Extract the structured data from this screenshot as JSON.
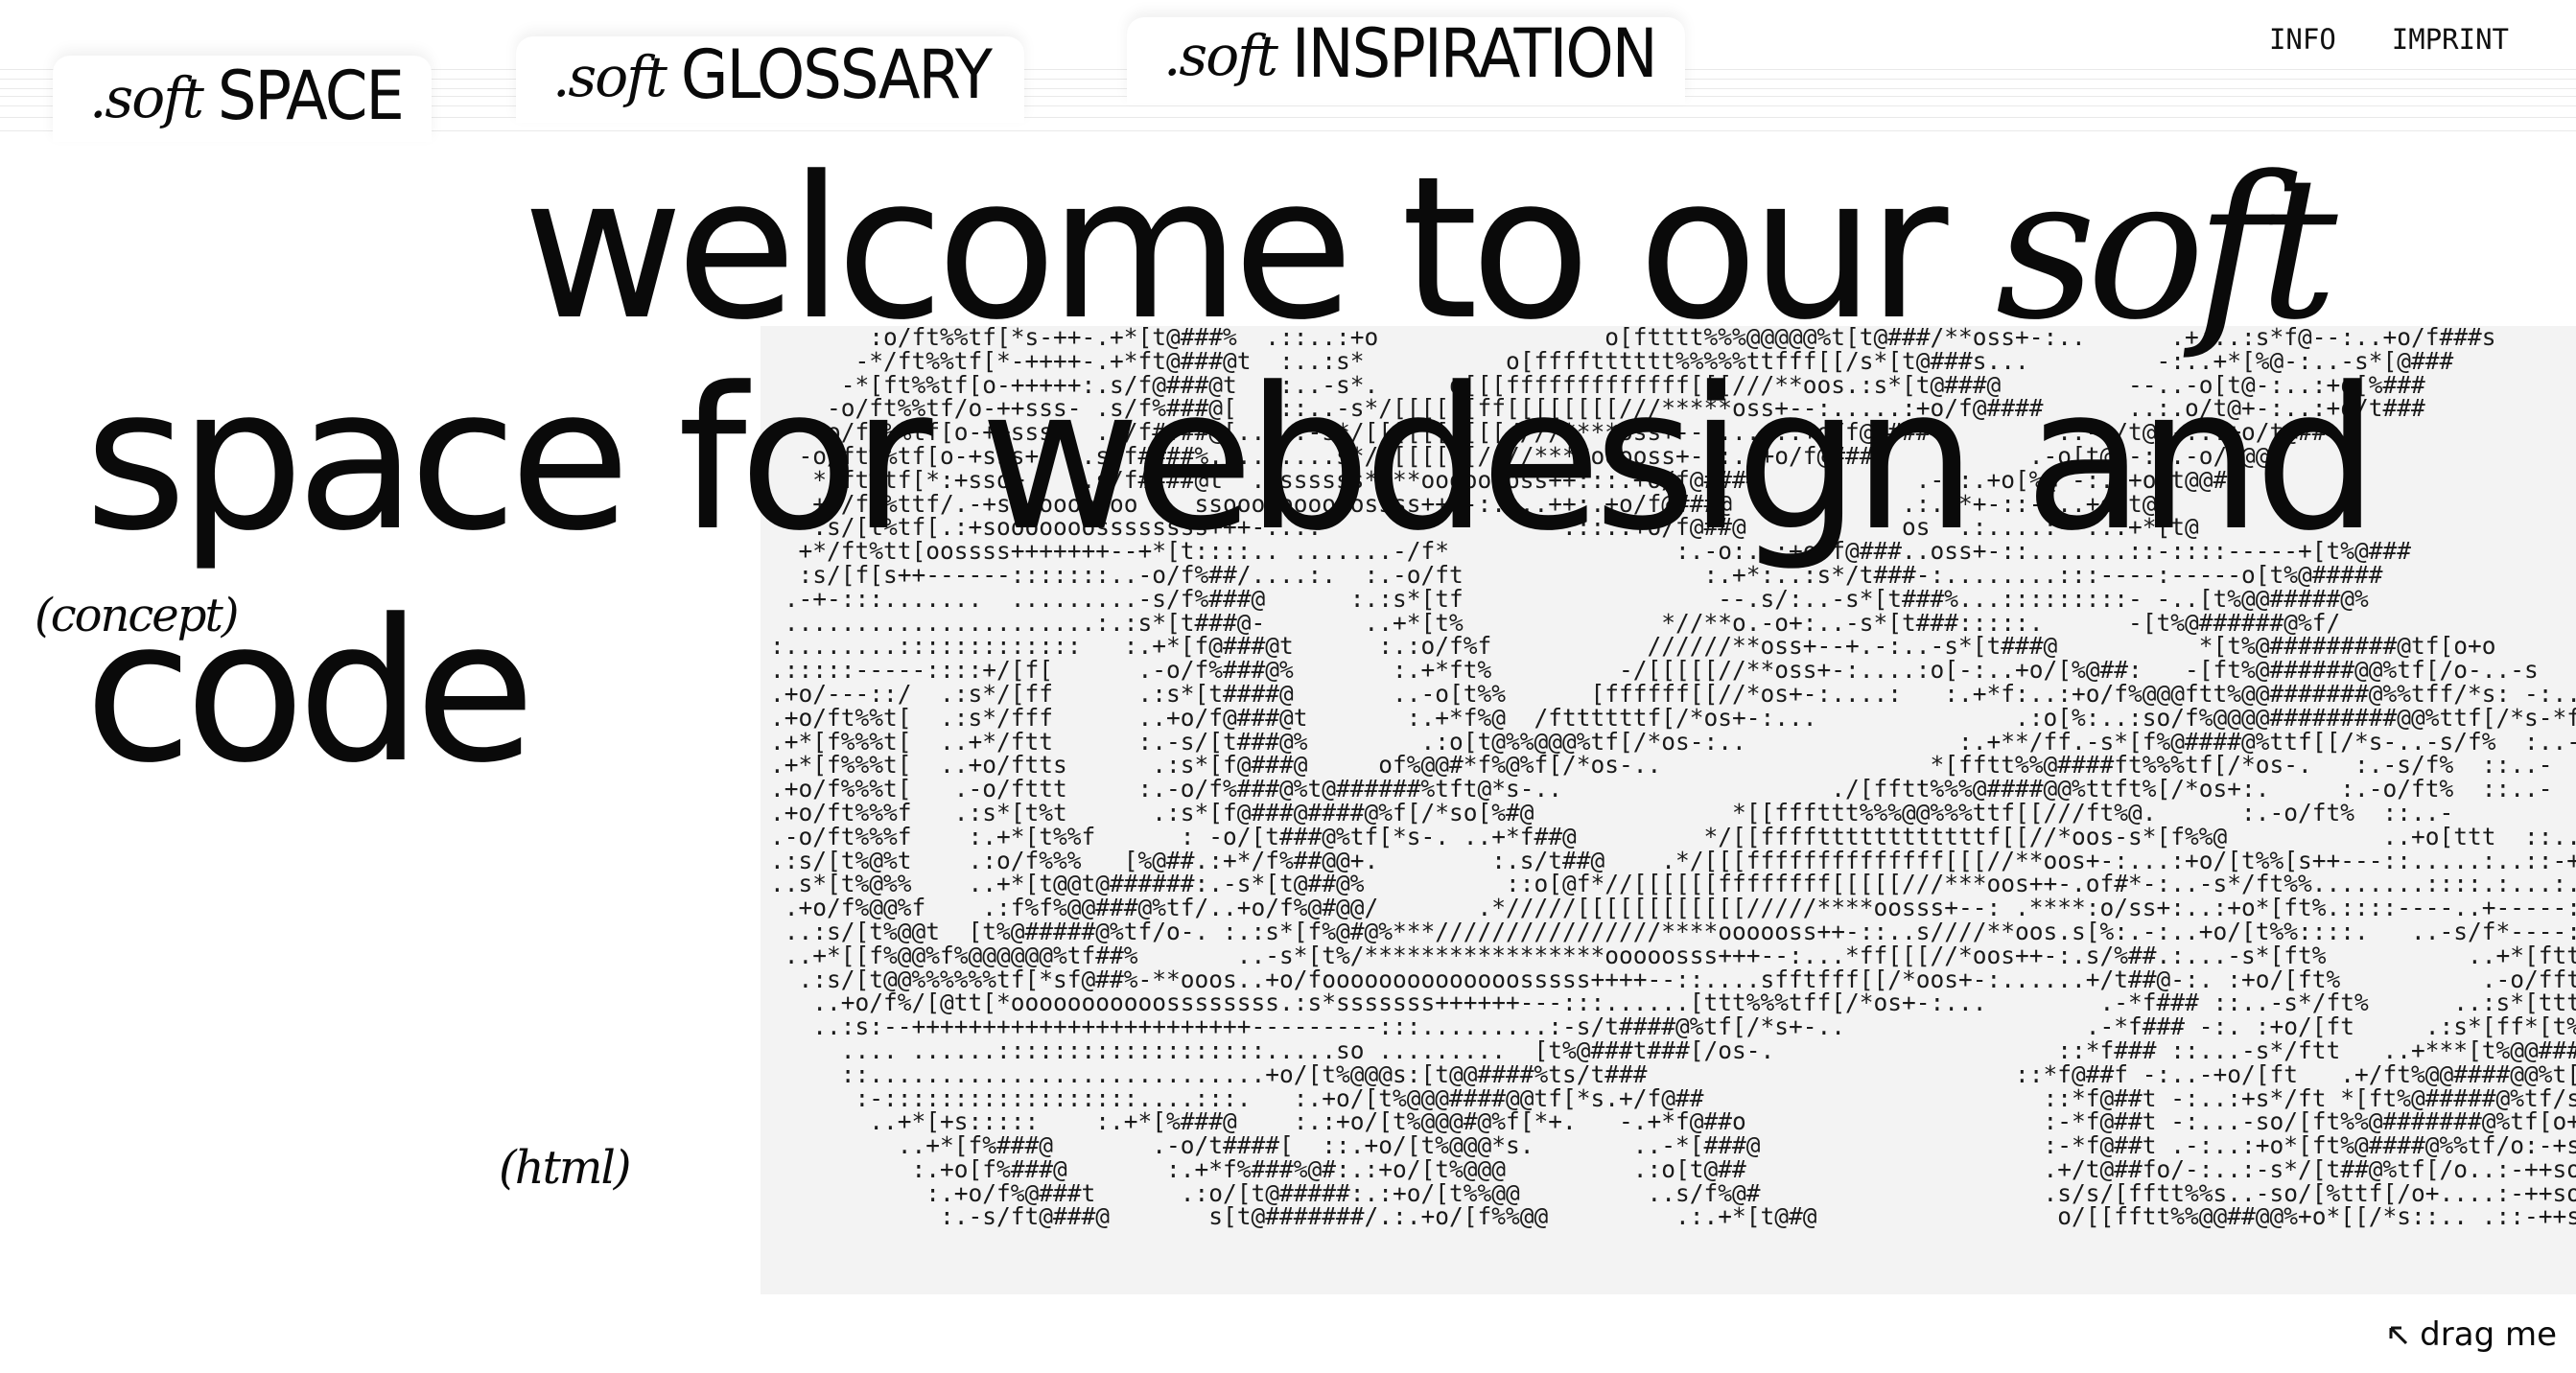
{
  "tabs": [
    {
      "prefix": ".soft",
      "label": "SPACE"
    },
    {
      "prefix": ".soft",
      "label": "GLOSSARY"
    },
    {
      "prefix": ".soft",
      "label": "INSPIRATION"
    }
  ],
  "nav": {
    "info": "INFO",
    "imprint": "IMPRINT"
  },
  "hero": {
    "line1": "welcome to our",
    "soft": "soft",
    "line2": "space for webdesign and",
    "line3": "code"
  },
  "annotations": {
    "concept": "(concept)",
    "html": "(html)"
  },
  "drag": {
    "icon": "arrow-up-left-icon",
    "label": "drag me"
  },
  "ascii_art": [
    "       :o/ft%%tf[*s-++-.+*[t@###%  .::..:+o                o[ftttt%%%@@@@@%t[t@###/**oss+-:..      .+:..:s*f@--:..+o/f###s",
    "      -*/ft%%tf[*-++++-.+*ft@###@t  :..:s*          o[fffftttttt%%%%%ttfff[[/s*[t@###s...         -:..+*[%@-:..-s*[@###",
    "     -*[ft%%tf[o-+++++:.s/f@###@t   :..-s*.     o[[[fffffffffffff[[[///**oos.:s*[t@###@         --..-o[t@-:..:+o[%###",
    "    -o/ft%%tf/o-++sss- .s/f%###@[   ::..-s*/[[[[[[ff[[[[[[[[///*****oss+--:.....:+o/f@####      ..:.o/t@+-:..:+o/t###",
    "   -o/ft%%tf[o-++sss+  .s/f####@[.....-s*/[[[[[[[[[[////****oss+--:.....:+o/f@####         ..-o/t@%-:..+o/t@##",
    "  -o/ft%%tf[o-+sss+   .s/f####%.........s*//[[[[[[////****ooooss+-::.:+o/f@####          .-o[t@[-:..-o/f@@#",
    "   *[ft%tf[*:+sso+    .s/f####@t  .ossssss****oooooooss++:::.+o/f@####           .-.:.+o[%@ -:..+o/t@@#",
    "   +s/ft%ttf/.-+ss+ooooooo    ssoooooooooossss++--:....++:.+o/f@###@            .:.+*+-::-:..+o/t@",
    "   .s/[t%tf[.:+sooooooossssssss+++-:...                 .::.:+o/f@##@           os  .:....:--..:+*[t@",
    "  +*/ft%tt[oossss+++++++--+*[t::::.. .......-/f*                :.-o:..:+o/f@###..oss+-::.......::-::::-----+[t%@###",
    "  :s/[f[s++------:::::::..-o/f%##/....:.  :.-o/ft                 :.+*:..:s*/t###-:........:::----:-----o[t%@#####",
    " .-+-:::.......  .........-s/f%###@      :.:s*[tf                  --.s/:..-s*[t###%...:::::::::- -..[t%@@#####@%",
    " ......................:.:s*[t###@-       ..+*[t%              *//**o.-o+:..-s*[t###:::::.      -[t%@######@%f/",
    ":........:::::::::::::   :.+*[f@###@t      :.:o/f%f           //////**oss+--+.-:..-s*[t###@          *[t%@#########@tf[o+o",
    ".:::::-----::::+/[f[      .-o/f%###@%       :.+*ft%         -/[[[[[//**oss+-:....:o[-:..+o/[%@##:   -[ft%@######@@%tf[/o-..-s",
    ".+o/---::/  .:s*/[ff      .:s*[t####@       ..-o[t%%      [ffffff[[//*os+-:....:   :.+*f:..:+o/f%@@@ftt%@@#######@%%tff/*s: -:..:s",
    ".+o/ft%%t[  .:s*/fff      ..+o/f@###@t       :.+*f%@  /fttttttf[/*os+-:...              .:o[%:..:so/f%@@@@#########@@%ttf[/*s-*f%%  :..+",
    ".+*[f%%%t[  ..+*/ftt      :.-s/[t###@%        .:o[t@%%@@@%tf[/*os-:..               :.+**/ff.-s*[f%@####@%ttf[[/*s-..-s/f%  :..-",
    ".+*[f%%%t[  ..+o/ftts      .:s*[f@###@     of%@@#*f%@%f[/*os-..                   *[fftt%%@####ft%%%tf[/*os-.   :.-s/f%  ::..-",
    ".+o/f%%%t[   .-o/fttt     :.-o/f%###@%t@######%tft@*s-..                   ./[fftt%%%@####@@%ttft%[/*os+:.     :.-o/ft%  ::..-",
    ".+o/ft%%%f   .:s*[t%t      .:s*[f@###@####@%f[/*so[%#@              *[[fffttt%%%@@%%%ttf[[///ft%@.      :.-o/ft%  ::..-",
    ".-o/ft%%%f    :.+*[t%%f      : -o/[t###@%tf[*s-. ..+*f##@         */[[ffffttttttttttttf[[//*oos-s*[f%%@           ..+o[ttt  ::..-",
    ".:s/[t%@%t    .:o/f%%%   [%@##.:+*/f%##@@+.        :.s/t##@    .*/[[[ffffffffffffff[[[//**oos+-:...:+o/[t%%[s++---::.....:..::-+s:...",
    "..s*[t%@%%    ..+*[t@@t@######:.-s*[t@##@%          ::o[@f*//[[[[[[ffffffff[[[[[///***oos++-.of#*-:..-s*/ft%%........::::.:...:...",
    " .+o/f%@@%f    .:f%f%@@###@%tf/..+o/f%@#@@/       .*/////[[[[[[[[[[[[/////****oosss+--: .****:o/ss+:..:+o*[ft%.::::----..+-----::::.:+",
    " ..:s/[t%@@t  [t%@#####@%tf/o-. :.:s*[f%@#@%***////////////////****oooooss++-::..s////**oos.s[%:.-:..+o/[t%%::::.   ..-s/f*----:..-+",
    " ..+*[[f%@@%f%@@@@@@%tf##%       ..-s*[t%/*****************ooooosss+++--:...*ff[[[//*oos++-:.s/%##.:...-s*[ft%          ..+*[ftt   :*[t@",
    "  .:s/[t@@%%%%%%tf[*sf@##%-**ooos..+o/foooooooooooooosssss++++--::....sfftfff[[/*oos+-:......+/t##@-:. :+o/[ft%          .-o/fftt .*[t%@#",
    "   ..+o/f%/[@tt[*ooooooooooossssssss.:s*sssssss++++++---:::......[ttt%%%tff[/*os+-:...        .-*f### ::..-s*/ft%      ..:s*[ttt+/ft@@###",
    "   ..:s:--++++++++++++++++++++++++---------:::.........:-s/t####@%tf[/*s+-..                 .-*f### -:. :+o/[ft     .:s*[ff*[t%@######",
    "     .... ......:::::::::::::::::::.....so .........  [t%@###t###[/os-.                    ::*f### ::...-s*/ftt   ..+***[t%@@####@%f",
    "     ::............................+o/[t%@@@s:[t@@####%ts/t###                          ::*f@##f -:..-+o/[ft   .+/ft%@@####@@%t[s*",
    "      :-::::::::::::::::::....:::.   :.+o/[t%@@@####@@tf[*s.+/f@##                        ::*f@##t -:..:+s*/ft *[ft%@#####@%tf/so**",
    "       ..+*[+s:::::    :.+*[%###@    :.:+o/[t%@@@#@%f[*+.   -.+*f@##o                     :-*f@##t -:...-so/[ft%%@#######@%tf[o+soo*",
    "         ..+*[f%###@       .-o/t####[  ::.+o/[t%@@@*s.       ..-*[###@                    :-*f@##t .-:..:+o*[ft%@####@%%tf/o:-+ssoo",
    "          :.+o[f%###@       :.+*f%###%@#:.:+o/[t%@@@         .:o[t@##                     .+/t@##fo/-:..:-s*/[t##@%tf[/o..:-++soo",
    "           :.+o/f%@###t      .:o/[t@#####:.:+o/[t%%@@         ..s/f%@#                    .s/s/[fftt%%s..-so/[%ttf[/o+....:-++soo",
    "            :.-s/ft@###@       s[t@#######/.:.+o/[f%%@@         .:.+*[t@#@                 o/[[fftt%%@@##@@%+o*[[/*s::.. .::-++ss"
  ]
}
